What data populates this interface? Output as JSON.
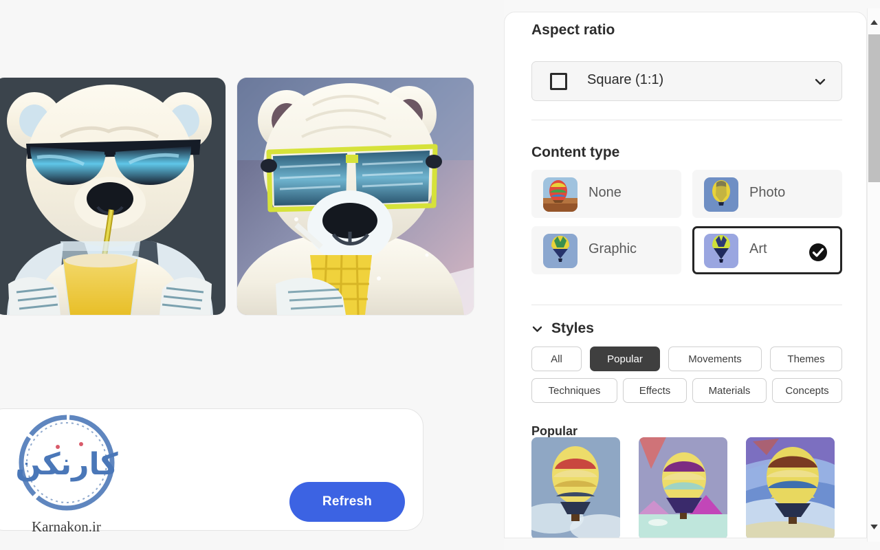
{
  "canvas": {
    "results": [
      {
        "name": "polar-bear-dark-sunglasses",
        "alt": "Polar bear wearing dark sunglasses drinking a yellow beverage with a straw on a dark slate background"
      },
      {
        "name": "polar-bear-yellow-sunglasses",
        "alt": "Polar bear wearing yellow-rimmed mirrored sunglasses holding a yellow cup with a straw on a pastel gradient background"
      }
    ]
  },
  "prompt_card": {
    "refresh_label": "Refresh"
  },
  "watermark": {
    "stamp_text": "کارنکن",
    "url": "Karnakon.ir"
  },
  "panel": {
    "aspect_ratio": {
      "title": "Aspect ratio",
      "icon": "square-icon",
      "value": "Square (1:1)",
      "chevron": "chevron-down-icon"
    },
    "content_type": {
      "title": "Content type",
      "options": [
        {
          "label": "None",
          "selected": false,
          "thumb": "balloon-rainbow-desert"
        },
        {
          "label": "Photo",
          "selected": false,
          "thumb": "balloon-yellow-sky"
        },
        {
          "label": "Graphic",
          "selected": false,
          "thumb": "balloon-multicolor-flat"
        },
        {
          "label": "Art",
          "selected": true,
          "thumb": "balloon-green-navy-art"
        }
      ],
      "selected_value": "Art",
      "check_icon": "check-circle-icon"
    },
    "styles": {
      "title": "Styles",
      "chevron": "chevron-down-icon",
      "expanded": true,
      "filters": [
        {
          "label": "All",
          "active": false
        },
        {
          "label": "Popular",
          "active": true
        },
        {
          "label": "Movements",
          "active": false
        },
        {
          "label": "Themes",
          "active": false
        },
        {
          "label": "Techniques",
          "active": false
        },
        {
          "label": "Effects",
          "active": false
        },
        {
          "label": "Materials",
          "active": false
        },
        {
          "label": "Concepts",
          "active": false
        }
      ],
      "group_title": "Popular",
      "thumbnails": [
        {
          "name": "style-thumb-photoreal-balloon"
        },
        {
          "name": "style-thumb-pastel-balloon"
        },
        {
          "name": "style-thumb-painterly-balloon"
        }
      ]
    }
  },
  "scrollbar": {
    "up_icon": "triangle-up-icon",
    "down_icon": "triangle-down-icon"
  },
  "colors": {
    "accent_blue": "#3c63e3",
    "chip_active": "#3f3f3f",
    "panel_bg": "#ffffff",
    "page_bg": "#f7f7f7",
    "watermark_blue": "#5f86bf"
  }
}
